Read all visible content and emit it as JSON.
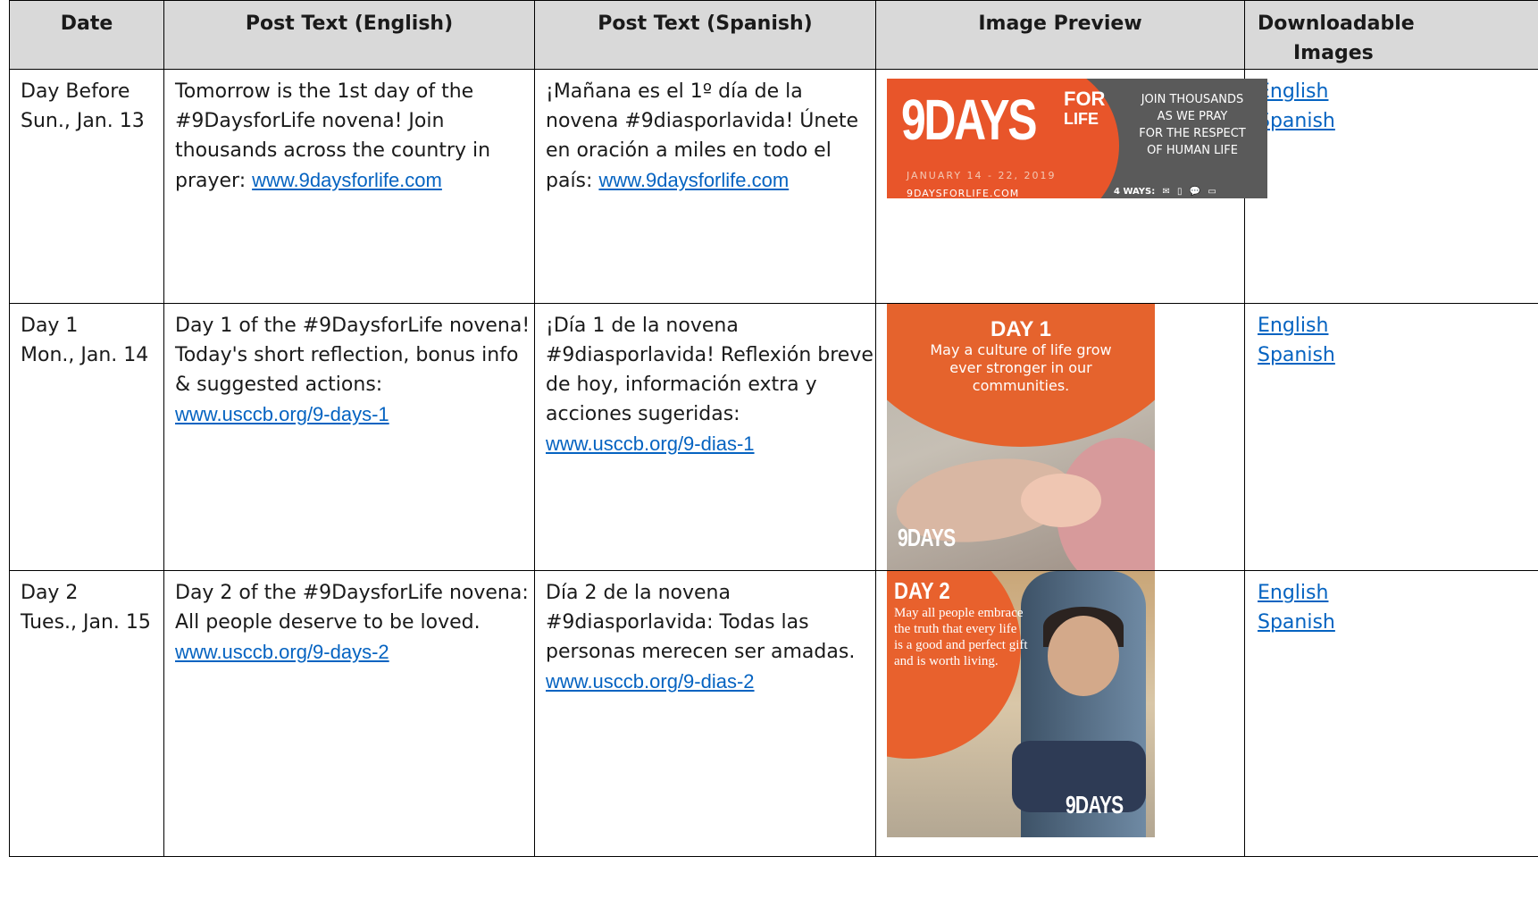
{
  "headers": [
    "Date",
    "Post Text (English)",
    "Post Text (Spanish)",
    "Image Preview",
    [
      "Downloadable",
      "Images"
    ]
  ],
  "rows": [
    {
      "date": [
        "Day Before",
        "Sun., Jan. 13"
      ],
      "english_lines": [
        "Tomorrow is the 1st day of the",
        "#9DaysforLife novena! Join",
        "thousands across the country in"
      ],
      "english_prefix": "prayer: ",
      "english_link": "www.9daysforlife.com",
      "spanish_lines": [
        "¡Mañana es el 1º día de la",
        "novena #9diasporlavida! Únete",
        "en oración a miles en todo el"
      ],
      "spanish_prefix": "país: ",
      "spanish_link": "www.9daysforlife.com",
      "links": [
        "English",
        "Spanish"
      ],
      "image": {
        "big": "9DAYS",
        "for": "FOR",
        "life": "LIFE",
        "dates": "JANUARY 14 - 22, 2019",
        "site": "9DAYSFORLIFE.COM",
        "join": [
          "JOIN THOUSANDS",
          "AS WE PRAY",
          "FOR THE RESPECT",
          "OF HUMAN LIFE"
        ],
        "ways": "4 WAYS:",
        "ways_icons": [
          "✉",
          "▯",
          "💬",
          "▭"
        ]
      }
    },
    {
      "date": [
        "Day 1",
        "Mon., Jan. 14"
      ],
      "english_lines": [
        "Day 1 of the #9DaysforLife novena!",
        "Today's short reflection, bonus info",
        "& suggested actions:"
      ],
      "english_prefix": "",
      "english_link": "www.usccb.org/9-days-1",
      "spanish_lines": [
        "¡Día 1 de la novena",
        "#9diasporlavida! Reflexión breve",
        "de hoy, información extra y",
        "acciones sugeridas:"
      ],
      "spanish_prefix": "",
      "spanish_link": "www.usccb.org/9-dias-1",
      "links": [
        "English",
        "Spanish"
      ],
      "image": {
        "title": "DAY 1",
        "body": "May a culture of life grow ever stronger in our communities.",
        "logo": "9DAYS"
      }
    },
    {
      "date": [
        "Day 2",
        "Tues., Jan. 15"
      ],
      "english_lines": [
        "Day 2 of the #9DaysforLife novena:",
        "All people deserve to be loved."
      ],
      "english_prefix": "",
      "english_link": "www.usccb.org/9-days-2",
      "spanish_lines": [
        "Día 2 de la novena",
        "#9diasporlavida: Todas las",
        "personas merecen ser amadas."
      ],
      "spanish_prefix": "",
      "spanish_link": "www.usccb.org/9-dias-2",
      "links": [
        "English",
        "Spanish"
      ],
      "image": {
        "title": "DAY 2",
        "body": "May all people embrace the truth that every life is a good and perfect gift and is worth living.",
        "logo": "9DAYS"
      }
    }
  ]
}
